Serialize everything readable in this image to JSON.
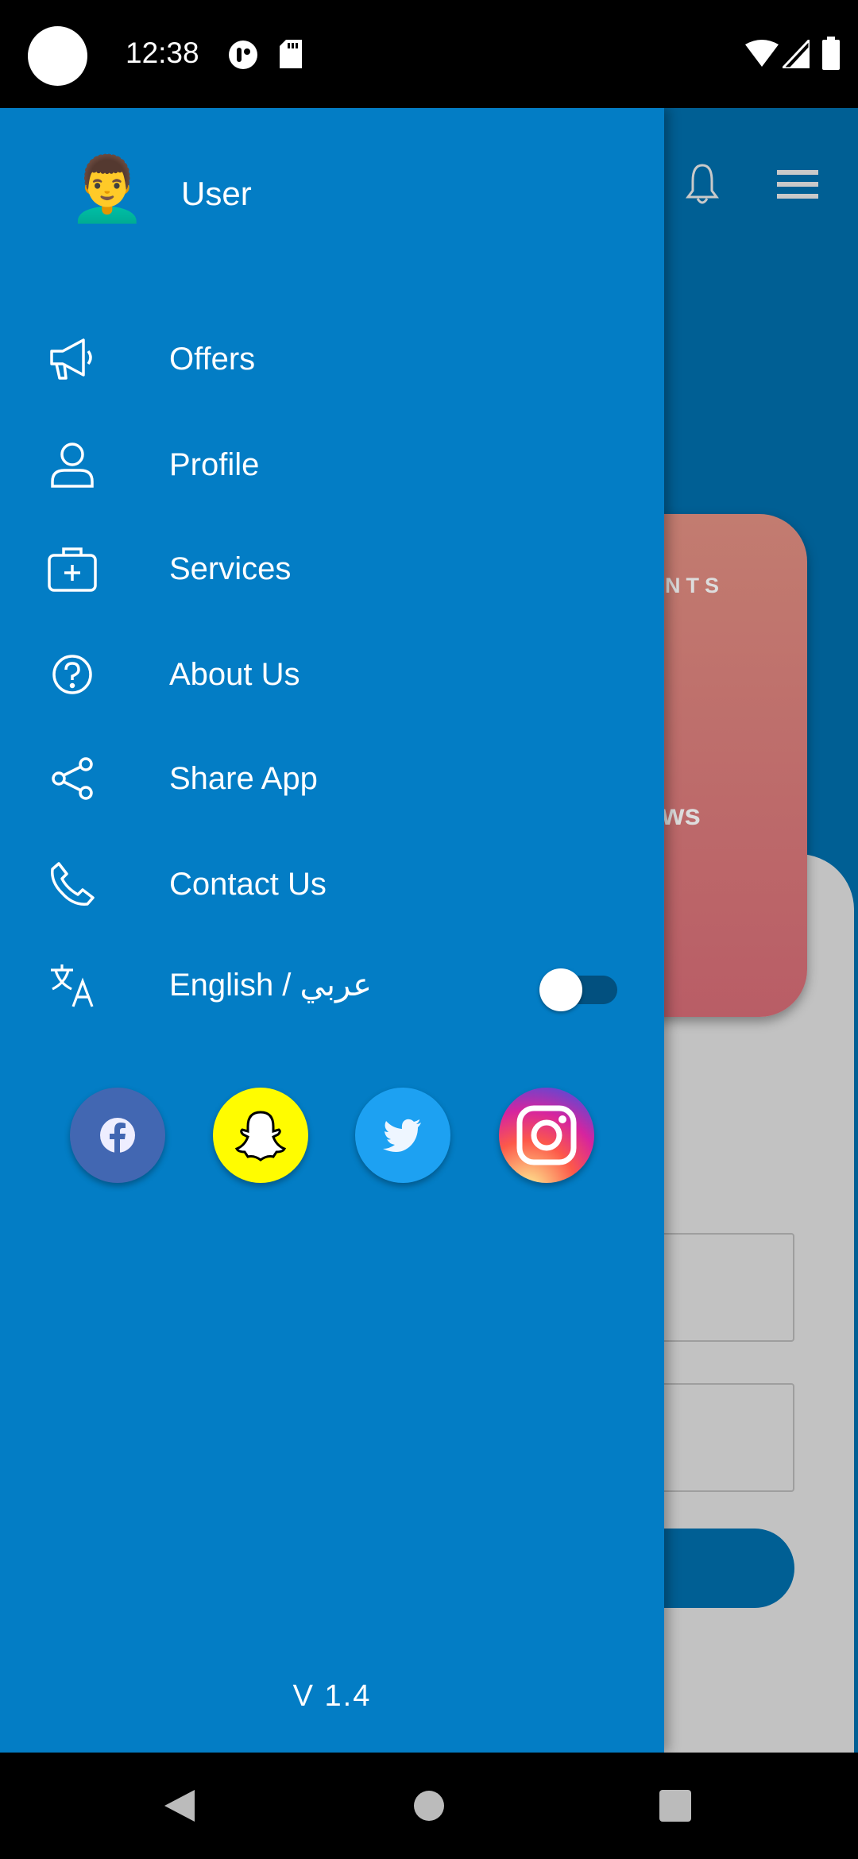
{
  "status_bar": {
    "time": "12:38"
  },
  "background": {
    "card_title": "ENTS",
    "card_subtitle": "ews"
  },
  "drawer": {
    "user": {
      "name": "User",
      "avatar": "man-emoji"
    },
    "items": [
      {
        "label": "Offers",
        "icon": "megaphone-icon"
      },
      {
        "label": "Profile",
        "icon": "person-icon"
      },
      {
        "label": "Services",
        "icon": "medical-kit-icon"
      },
      {
        "label": "About Us",
        "icon": "help-circle-icon"
      },
      {
        "label": "Share App",
        "icon": "share-icon"
      },
      {
        "label": "Contact Us",
        "icon": "phone-icon"
      }
    ],
    "language": {
      "label": "English / عربي",
      "icon": "translate-icon",
      "toggle_on": false
    },
    "social": [
      {
        "name": "facebook",
        "color": "#4267b2"
      },
      {
        "name": "snapchat",
        "color": "#fffc00"
      },
      {
        "name": "twitter",
        "color": "#1da1f2"
      },
      {
        "name": "instagram",
        "color": "#c13584"
      }
    ],
    "version": "V 1.4"
  },
  "colors": {
    "drawer": "#037dc5",
    "app_bar": "#005f94"
  }
}
